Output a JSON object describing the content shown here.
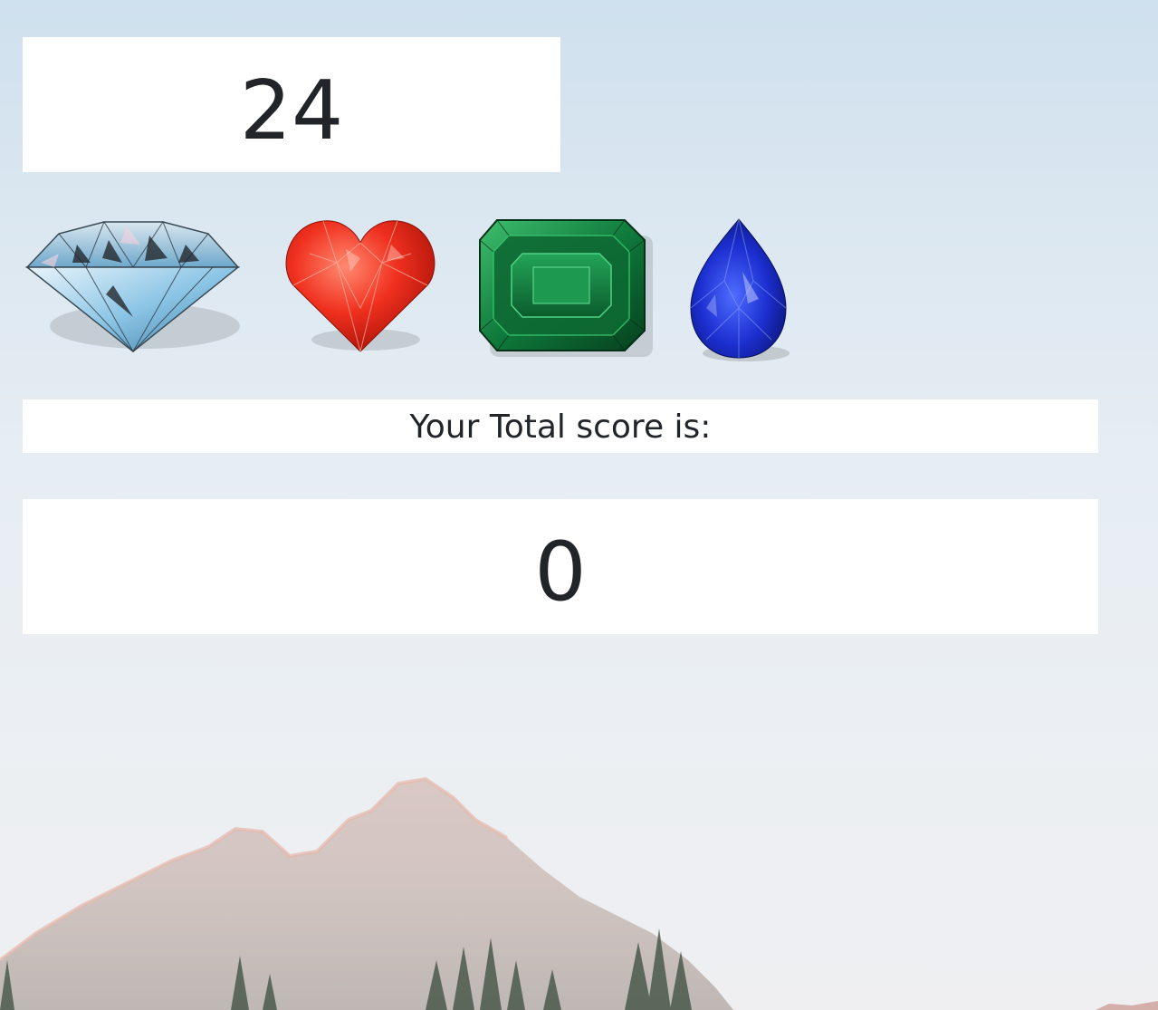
{
  "game": {
    "target_score": "24",
    "total_label": "Your Total score is:",
    "total_score": "0"
  },
  "crystals": [
    {
      "name": "diamond",
      "icon": "diamond-gem-icon",
      "color": "#a9d4ec"
    },
    {
      "name": "ruby heart",
      "icon": "ruby-heart-gem-icon",
      "color": "#e8281b"
    },
    {
      "name": "emerald",
      "icon": "emerald-gem-icon",
      "color": "#168a45"
    },
    {
      "name": "sapphire",
      "icon": "sapphire-gem-icon",
      "color": "#1a2fc4"
    }
  ],
  "colors": {
    "panel_bg": "#ffffff",
    "text": "#212529",
    "sky": "#dce8f1"
  }
}
